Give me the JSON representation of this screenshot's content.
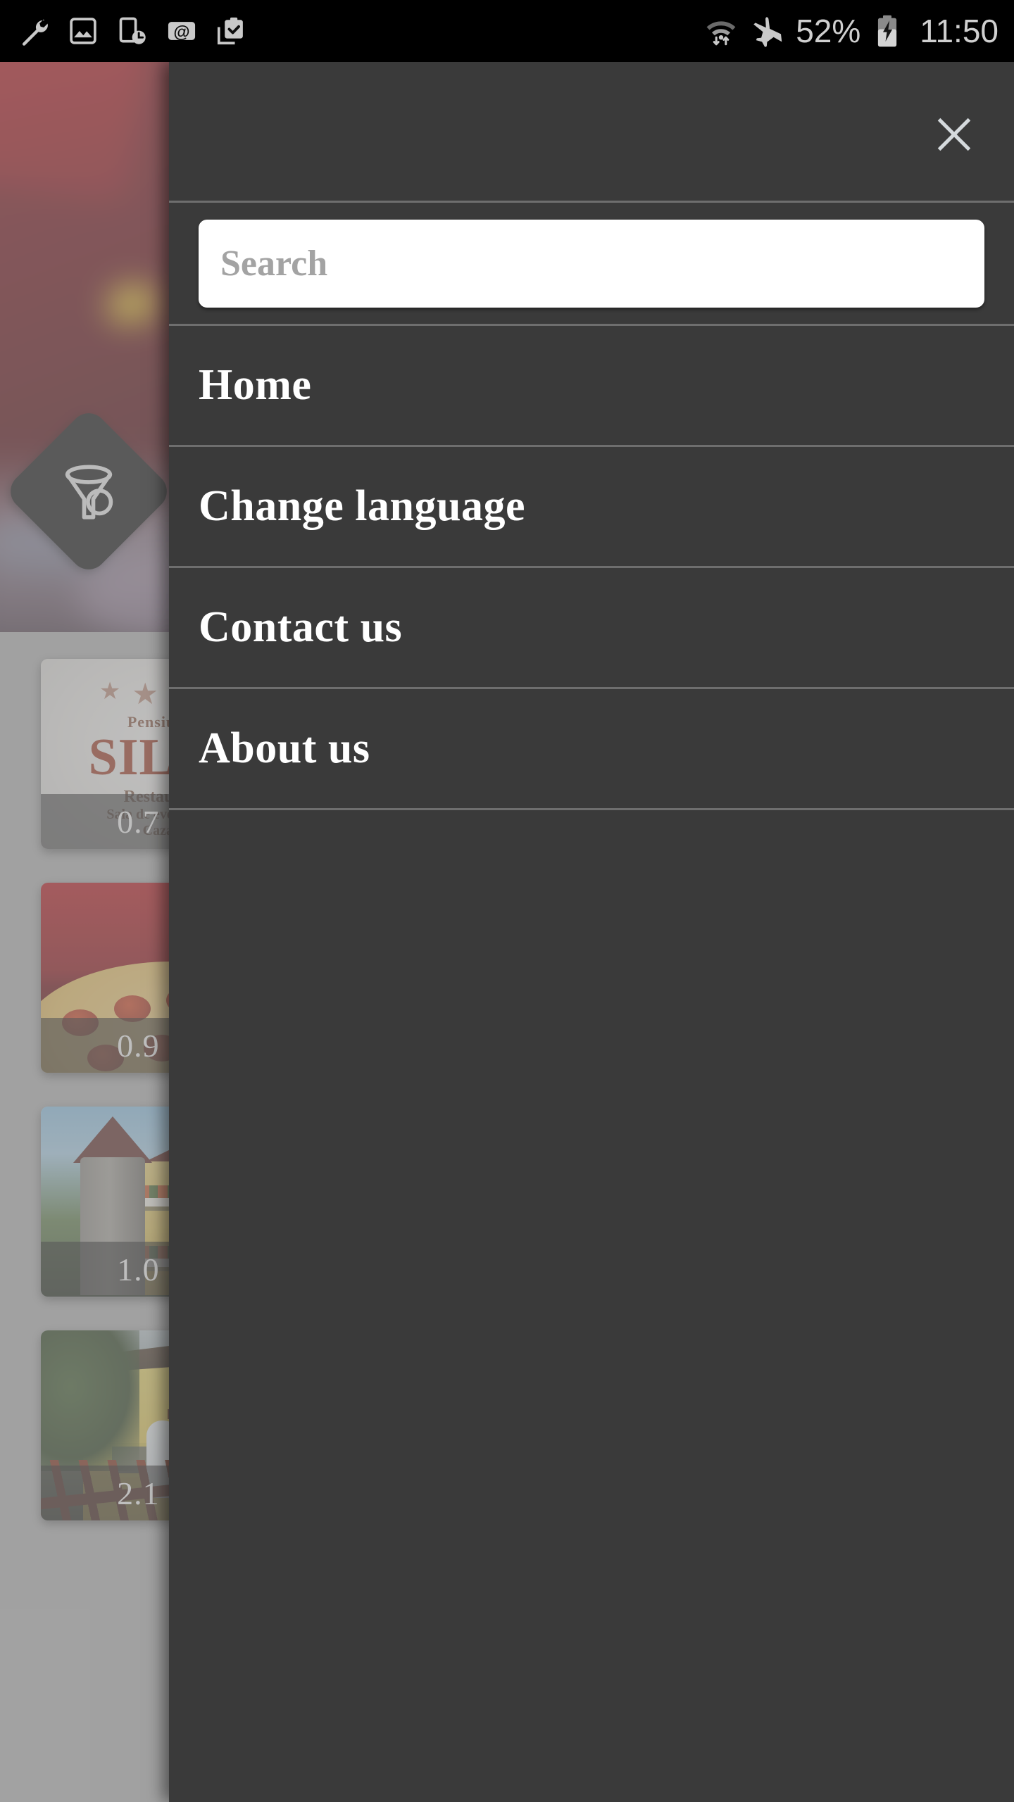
{
  "status_bar": {
    "left_icons": [
      {
        "name": "wrench-icon",
        "glyph": "wrench"
      },
      {
        "name": "image-icon",
        "glyph": "image"
      },
      {
        "name": "device-clock-icon",
        "glyph": "device-clock"
      },
      {
        "name": "email-at-icon",
        "glyph": "at"
      },
      {
        "name": "clipboard-check-icon",
        "glyph": "clipboard-check"
      }
    ],
    "wifi_icon": "wifi-with-transfer-arrows",
    "airplane_icon": "airplane-mode-icon",
    "battery_percent": "52%",
    "battery_icon": "battery-charging-icon",
    "clock": "11:50",
    "background_color": "#000000",
    "text_color": "#cfcfcf"
  },
  "drawer": {
    "background_color": "#3a3a3a",
    "divider_color": "#6e6e6e",
    "close_label": "×",
    "close_icon": "close-x-icon",
    "search": {
      "placeholder": "Search",
      "value": ""
    },
    "menu_items": [
      {
        "label": "Home",
        "name": "drawer-item-home"
      },
      {
        "label": "Change language",
        "name": "drawer-item-change-language"
      },
      {
        "label": "Contact us",
        "name": "drawer-item-contact-us"
      },
      {
        "label": "About us",
        "name": "drawer-item-about-us"
      }
    ]
  },
  "app_background": {
    "filter_icon": "funnel-filter-icon",
    "hero_alt": "blurred cocktail drink photo",
    "cards": [
      {
        "distance": "0.7 km",
        "name": "card-pensiunea-silva",
        "logo_sub": "Pensiunea",
        "logo_main": "SILVA",
        "logo_line1": "Restaurant",
        "logo_line2": "Sala de evenimente",
        "logo_line3": "Cazare",
        "stars": "★ ★ ★ ★"
      },
      {
        "distance": "0.9 km",
        "name": "card-pizza",
        "alt": "pepperoni pizza on red background"
      },
      {
        "distance": "1.0 km",
        "name": "card-castle-inn",
        "alt": "Castle Inn guesthouse with stone tower"
      },
      {
        "distance": "2.1 km",
        "name": "card-yellow-guesthouse",
        "alt": "yellow guesthouse with balconies"
      }
    ]
  }
}
